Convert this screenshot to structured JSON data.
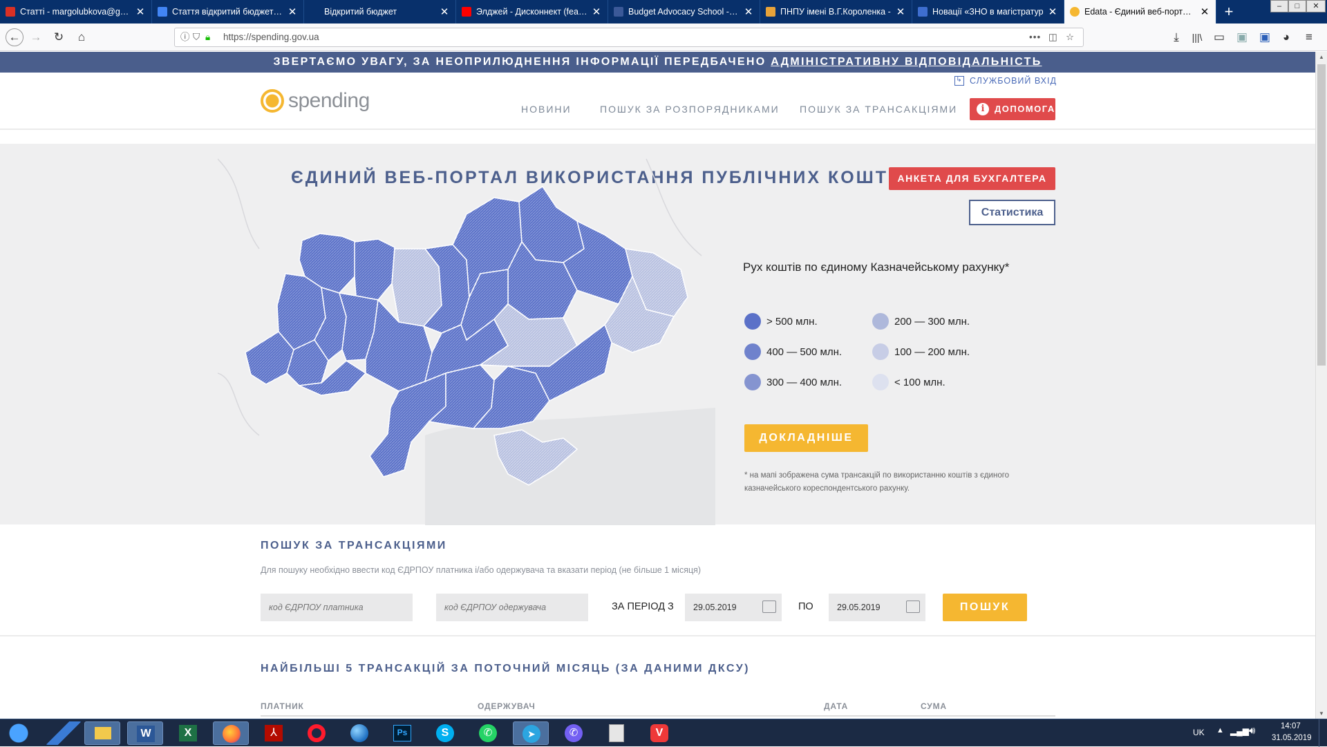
{
  "browser": {
    "tabs": [
      {
        "title": "Статті - margolubkova@gma",
        "icon_color": "#d93025"
      },
      {
        "title": "Стаття відкритий бюджет - G",
        "icon_color": "#4285f4"
      },
      {
        "title": "Відкритий бюджет",
        "icon_color": "#08306b"
      },
      {
        "title": "Элджей - Дисконнект (feat. K",
        "icon_color": "#ff0000"
      },
      {
        "title": "Budget Advocacy School - Гл",
        "icon_color": "#3b5998"
      },
      {
        "title": "ПНПУ імені В.Г.Короленка -",
        "icon_color": "#e8a33a"
      },
      {
        "title": "Новації «ЗНО в магістратур",
        "icon_color": "#3e6ecf"
      },
      {
        "title": "Edata - Єдиний веб-портал в",
        "icon_color": "#f5b731"
      }
    ],
    "new_tab": "+",
    "url": "https://spending.gov.ua",
    "window_controls": [
      "–",
      "□",
      "✕"
    ]
  },
  "notice": {
    "text": "ЗВЕРТАЄМО УВАГУ, ЗА НЕОПРИЛЮДНЕННЯ ІНФОРМАЦІЇ ПЕРЕДБАЧЕНО ",
    "link": "АДМІНІСТРАТИВНУ ВІДПОВІДАЛЬНІСТЬ"
  },
  "header": {
    "logo_text": "spending",
    "service_login": "СЛУЖБОВИЙ ВХІД",
    "nav": [
      "НОВИНИ",
      "ПОШУК ЗА РОЗПОРЯДНИКАМИ",
      "ПОШУК ЗА ТРАНСАКЦІЯМИ"
    ],
    "help": "ДОПОМОГА"
  },
  "hero": {
    "title": "ЄДИНИЙ ВЕБ-ПОРТАЛ ВИКОРИСТАННЯ ПУБЛІЧНИХ КОШТІВ",
    "anketa": "АНКЕТА ДЛЯ БУХГАЛТЕРА",
    "stats": "Статистика",
    "legend_title": "Рух коштів по єдиному Казначейському рахунку*",
    "legend": [
      {
        "label": "> 500 млн.",
        "color": "#5b71c8"
      },
      {
        "label": "200 — 300 млн.",
        "color": "#aeb8db"
      },
      {
        "label": "400 — 500 млн.",
        "color": "#6f82cc"
      },
      {
        "label": "100 — 200 млн.",
        "color": "#c7cde6"
      },
      {
        "label": "300 — 400 млн.",
        "color": "#8594d0"
      },
      {
        "label": "< 100 млн.",
        "color": "#dde1ef"
      }
    ],
    "more": "ДОКЛАДНІШЕ",
    "footnote": "* на мапі зображена сума трансакцій по використанню коштів з єдиного казначейського кореспондентського рахунку."
  },
  "search": {
    "title": "ПОШУК ЗА ТРАНСАКЦІЯМИ",
    "hint": "Для пошуку необхідно ввести код ЄДРПОУ платника і/або одержувача та вказати період (не більше 1 місяця)",
    "payer_placeholder": "код ЄДРПОУ платника",
    "receiver_placeholder": "код ЄДРПОУ одержувача",
    "period_label": "ЗА ПЕРІОД З",
    "date_from": "29.05.2019",
    "to_label": "ПО",
    "date_to": "29.05.2019",
    "button": "ПОШУК"
  },
  "top5": {
    "title": "НАЙБІЛЬШІ 5 ТРАНСАКЦІЙ ЗА ПОТОЧНИЙ МІСЯЦЬ (ЗА ДАНИМИ ДКСУ)",
    "columns": [
      "ПЛАТНИК",
      "ОДЕРЖУВАЧ",
      "ДАТА",
      "СУМА"
    ]
  },
  "taskbar": {
    "apps": [
      "start",
      "explorer-pin",
      "file-manager",
      "word",
      "excel",
      "firefox",
      "acrobat",
      "opera",
      "globe",
      "photoshop",
      "skype",
      "whatsapp",
      "telegram",
      "viber",
      "calculator",
      "vivaldi"
    ],
    "lang": "UK",
    "time": "14:07",
    "date": "31.05.2019"
  }
}
